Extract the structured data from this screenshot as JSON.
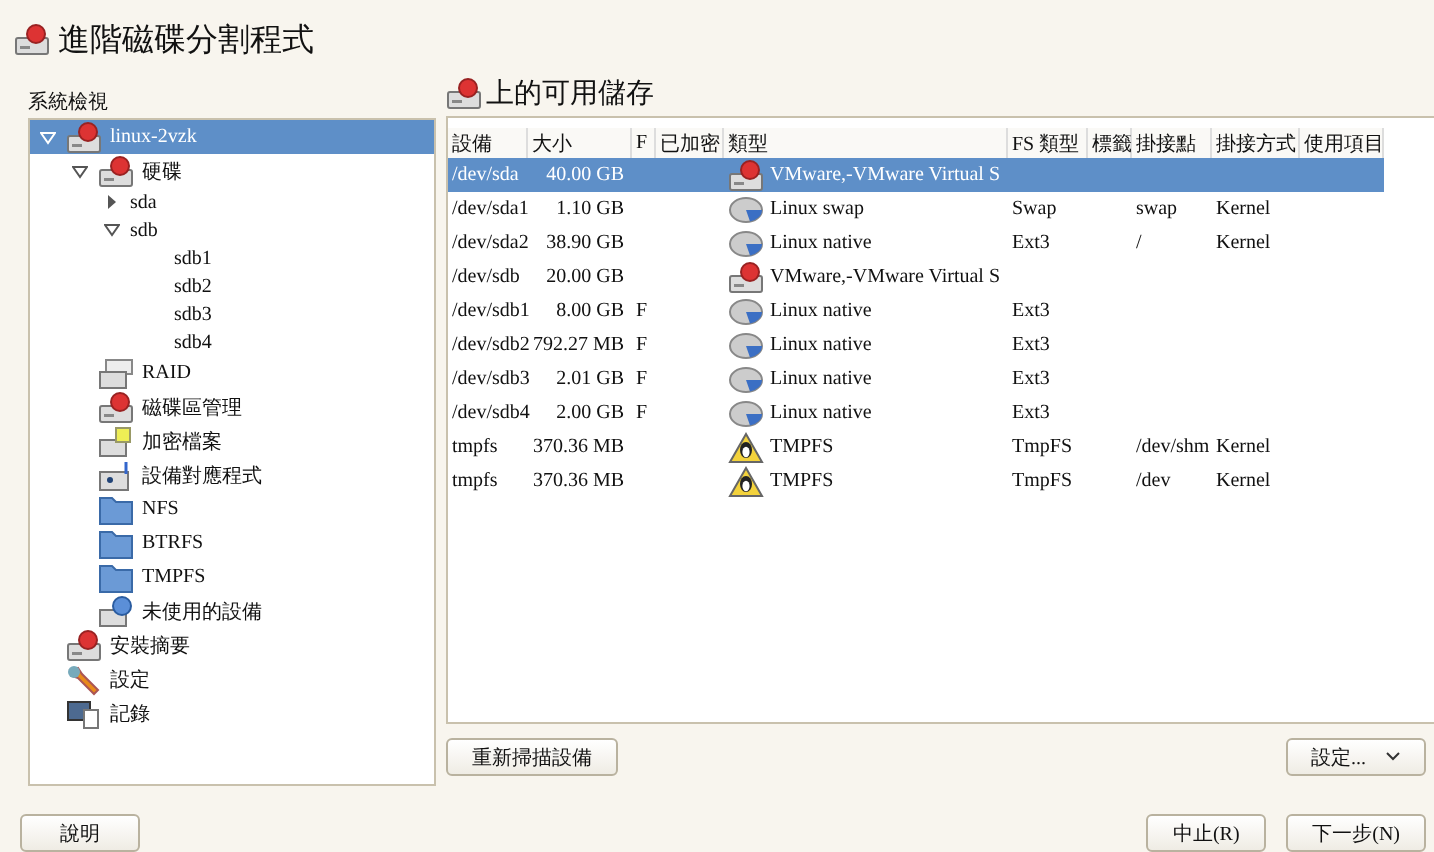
{
  "window": {
    "title": "進階磁碟分割程式"
  },
  "sidebar": {
    "label": "系統檢視",
    "tree": [
      {
        "label": "linux-2vzk",
        "kind": "computer",
        "selected": true,
        "expanded": true,
        "children": [
          {
            "label": "硬碟",
            "kind": "disk",
            "selected": false,
            "expanded": true,
            "children": [
              {
                "label": "sda",
                "kind": "plain",
                "selected": false,
                "expanded": false
              },
              {
                "label": "sdb",
                "kind": "plain",
                "selected": false,
                "expanded": true,
                "children": [
                  {
                    "label": "sdb1",
                    "kind": "plain",
                    "selected": false
                  },
                  {
                    "label": "sdb2",
                    "kind": "plain",
                    "selected": false
                  },
                  {
                    "label": "sdb3",
                    "kind": "plain",
                    "selected": false
                  },
                  {
                    "label": "sdb4",
                    "kind": "plain",
                    "selected": false
                  }
                ]
              }
            ]
          },
          {
            "label": "RAID",
            "kind": "raid",
            "selected": false
          },
          {
            "label": "磁碟區管理",
            "kind": "disk",
            "selected": false
          },
          {
            "label": "加密檔案",
            "kind": "crypt",
            "selected": false
          },
          {
            "label": "設備對應程式",
            "kind": "mapper",
            "selected": false
          },
          {
            "label": "NFS",
            "kind": "folder",
            "selected": false
          },
          {
            "label": "BTRFS",
            "kind": "folder",
            "selected": false
          },
          {
            "label": "TMPFS",
            "kind": "folder",
            "selected": false
          },
          {
            "label": "未使用的設備",
            "kind": "unused",
            "selected": false
          }
        ]
      },
      {
        "label": "安裝摘要",
        "kind": "disk",
        "selected": false
      },
      {
        "label": "設定",
        "kind": "wrench",
        "selected": false
      },
      {
        "label": "記錄",
        "kind": "log",
        "selected": false
      }
    ]
  },
  "panel": {
    "title": "上的可用儲存",
    "table": {
      "columns": [
        "設備",
        "大小",
        "F",
        "已加密",
        "類型",
        "FS 類型",
        "標籤",
        "掛接點",
        "掛接方式",
        "使用項目"
      ],
      "rows": [
        {
          "selected": true,
          "kind": "disk",
          "device": "/dev/sda",
          "size": "40.00 GB",
          "type": "VMware,-VMware Virtual S"
        },
        {
          "selected": false,
          "kind": "partition",
          "device": "/dev/sda1",
          "size": "1.10 GB",
          "type": "Linux swap",
          "fs_type": "Swap",
          "mount_point": "swap",
          "mount_by": "Kernel"
        },
        {
          "selected": false,
          "kind": "partition",
          "device": "/dev/sda2",
          "size": "38.90 GB",
          "type": "Linux native",
          "fs_type": "Ext3",
          "mount_point": "/",
          "mount_by": "Kernel"
        },
        {
          "selected": false,
          "kind": "disk",
          "device": "/dev/sdb",
          "size": "20.00 GB",
          "type": "VMware,-VMware Virtual S"
        },
        {
          "selected": false,
          "kind": "partition",
          "device": "/dev/sdb1",
          "size": "8.00 GB",
          "format": "F",
          "type": "Linux native",
          "fs_type": "Ext3"
        },
        {
          "selected": false,
          "kind": "partition",
          "device": "/dev/sdb2",
          "size": "792.27 MB",
          "format": "F",
          "type": "Linux native",
          "fs_type": "Ext3"
        },
        {
          "selected": false,
          "kind": "partition",
          "device": "/dev/sdb3",
          "size": "2.01 GB",
          "format": "F",
          "type": "Linux native",
          "fs_type": "Ext3"
        },
        {
          "selected": false,
          "kind": "partition",
          "device": "/dev/sdb4",
          "size": "2.00 GB",
          "format": "F",
          "type": "Linux native",
          "fs_type": "Ext3"
        },
        {
          "selected": false,
          "kind": "tmpfs",
          "device": "tmpfs",
          "size": "370.36 MB",
          "type": "TMPFS",
          "fs_type": "TmpFS",
          "mount_point": "/dev/shm",
          "mount_by": "Kernel"
        },
        {
          "selected": false,
          "kind": "tmpfs",
          "device": "tmpfs",
          "size": "370.36 MB",
          "type": "TMPFS",
          "fs_type": "TmpFS",
          "mount_point": "/dev",
          "mount_by": "Kernel"
        }
      ]
    },
    "rescan_button": "重新掃描設備",
    "configure_button": "設定..."
  },
  "buttons": {
    "help": "說明",
    "abort": "中止(R)",
    "next": "下一步(N)"
  }
}
